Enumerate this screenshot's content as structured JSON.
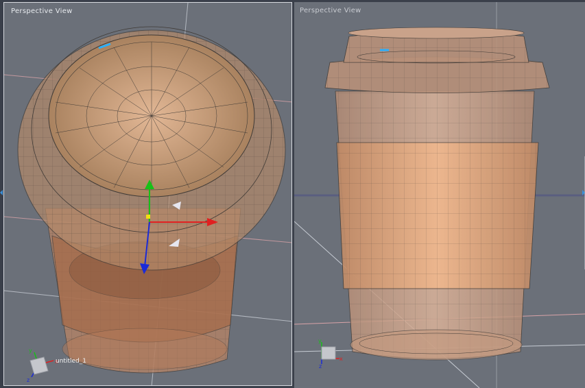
{
  "viewports": {
    "left": {
      "title": "Perspective View",
      "object_name": "untitled_1"
    },
    "right": {
      "title": "Perspective View"
    }
  },
  "axis_triad": {
    "x": "x",
    "y": "y",
    "z": "z"
  },
  "colors": {
    "viewport_bg": "#6b7079",
    "cup_fill": "#c49273",
    "sleeve_fill": "#c98c63",
    "wire": "#3f3a36",
    "grid_line": "#d9a3a8",
    "gizmo_x": "#e02020",
    "gizmo_y": "#18c018",
    "gizmo_z": "#1a2ad8",
    "selection_marker": "#2ab0ff"
  }
}
